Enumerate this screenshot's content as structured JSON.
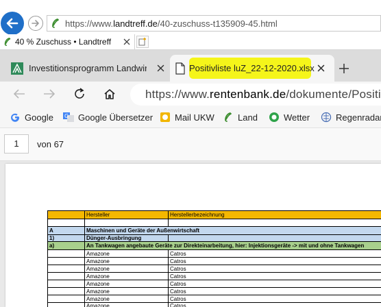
{
  "ie": {
    "url_prefix": "https://www.",
    "url_domain": "landtreff.de",
    "url_path": "/40-zuschuss-t135909-45.html",
    "tab_title": "40 % Zuschuss • Landtreff"
  },
  "edge": {
    "tabs": [
      {
        "title": "Investitionsprogramm Landwirtsc"
      },
      {
        "title": "Positivliste luZ_22-12-2020.xlsx"
      }
    ],
    "url_prefix": "https://www.",
    "url_domain": "rentenbank.de",
    "url_path": "/dokumente/Positiv",
    "favorites": [
      {
        "label": "Google",
        "icon": "google-icon"
      },
      {
        "label": "Google Übersetzer",
        "icon": "translate-icon"
      },
      {
        "label": "Mail UKW",
        "icon": "mail-icon"
      },
      {
        "label": "Land",
        "icon": "landtreff-icon"
      },
      {
        "label": "Wetter",
        "icon": "weather-icon"
      },
      {
        "label": "Regenradar",
        "icon": "radar-icon"
      }
    ]
  },
  "pdf": {
    "page": "1",
    "of_label": "von 67"
  },
  "colors": {
    "header_orange": "#f5b800",
    "section_blue": "#c3d8ee",
    "subsection_green": "#a8d08d",
    "highlight": "#f5f51a"
  },
  "sheet": {
    "header": [
      "",
      "Hersteller",
      "Herstellerbezeichnung"
    ],
    "section_a": {
      "code": "A",
      "label": "Maschinen und Geräte der Außenwirtschaft"
    },
    "section_1": {
      "code": "1)",
      "label": "Dünger-Ausbringung"
    },
    "section_a2": {
      "code": "a)",
      "label": "An Tankwagen angebaute Geräte zur Direkteinarbeitung, hier: Injektionsgeräte -> mit und ohne Tankwagen"
    },
    "rows": [
      {
        "maker": "Amazone",
        "model": "Catros"
      },
      {
        "maker": "Amazone",
        "model": "Catros"
      },
      {
        "maker": "Amazone",
        "model": "Catros"
      },
      {
        "maker": "Amazone",
        "model": "Catros"
      },
      {
        "maker": "Amazone",
        "model": "Catros"
      },
      {
        "maker": "Amazone",
        "model": "Catros"
      },
      {
        "maker": "Amazone",
        "model": "Catros"
      },
      {
        "maker": "Amazone",
        "model": "Catros"
      }
    ]
  }
}
